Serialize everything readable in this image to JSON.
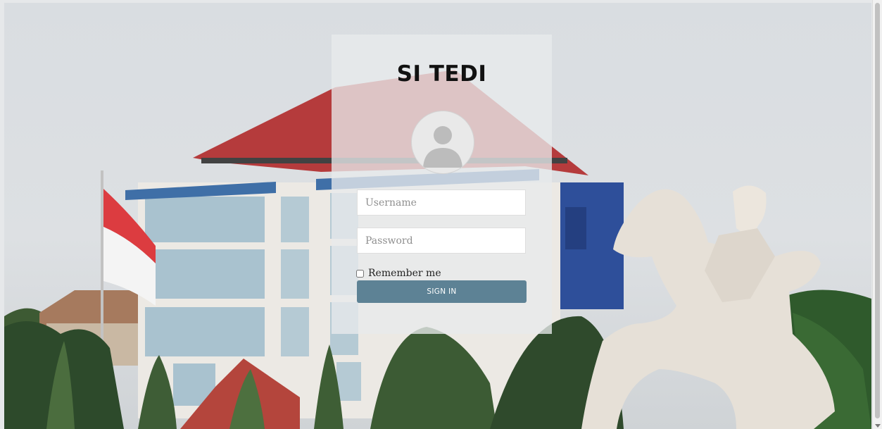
{
  "app": {
    "title": "SI TEDI"
  },
  "login_form": {
    "username": {
      "placeholder": "Username",
      "value": ""
    },
    "password": {
      "placeholder": "Password",
      "value": ""
    },
    "remember_me": {
      "label": "Remember me",
      "checked": false
    },
    "sign_in_label": "SIGN IN"
  },
  "icons": {
    "avatar": "user-avatar-icon"
  },
  "colors": {
    "primary_button": "#5d8295",
    "panel_background": "#e8eaec"
  }
}
